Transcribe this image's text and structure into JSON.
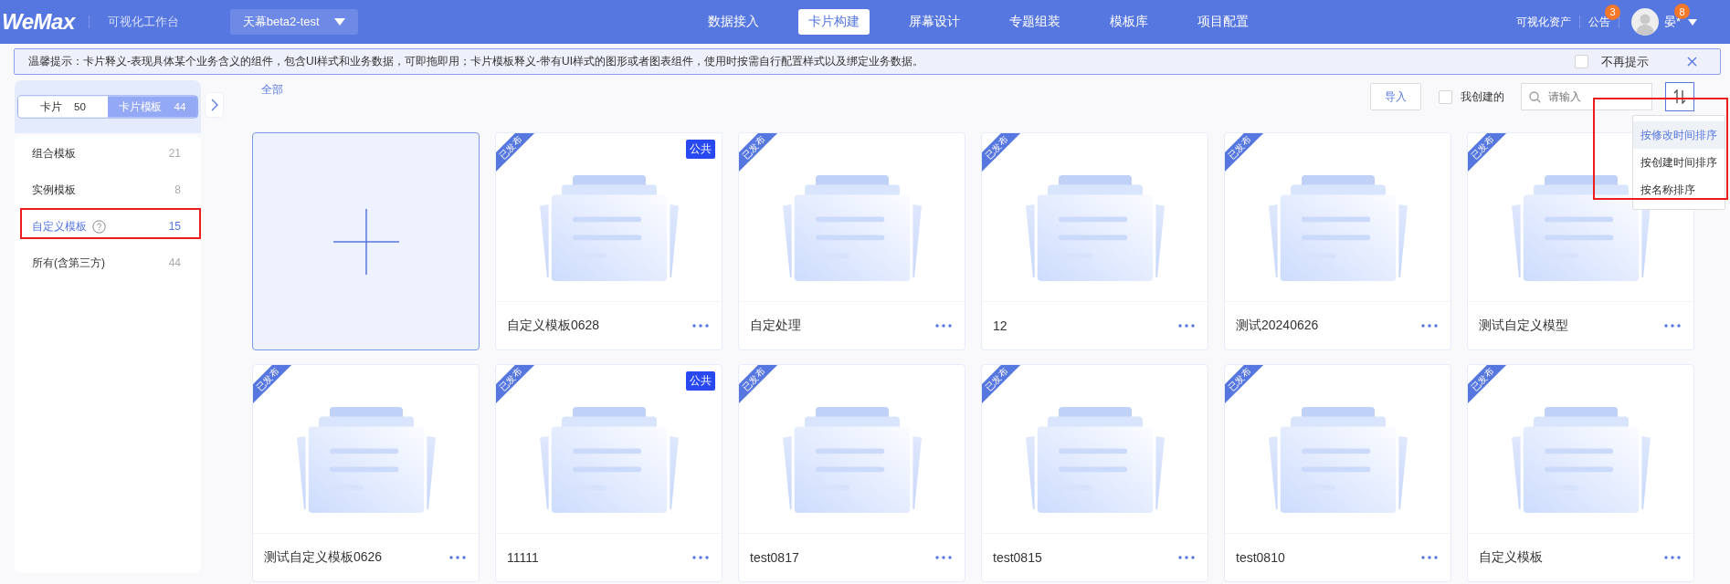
{
  "header": {
    "logo": "WeMax",
    "subtitle": "可视化工作台",
    "project": "天幕beta2-test",
    "nav": [
      {
        "label": "数据接入",
        "selected": false
      },
      {
        "label": "卡片构建",
        "selected": true
      },
      {
        "label": "屏幕设计",
        "selected": false
      },
      {
        "label": "专题组装",
        "selected": false
      },
      {
        "label": "模板库",
        "selected": false
      },
      {
        "label": "项目配置",
        "selected": false
      }
    ],
    "assets": "可视化资产",
    "notice": {
      "label": "公告",
      "badge": "3"
    },
    "user": {
      "name": "晏*",
      "badge": "8"
    }
  },
  "tip": {
    "text": "温馨提示：卡片释义-表现具体某个业务含义的组件，包含UI样式和业务数据，可即拖即用；卡片模板释义-带有UI样式的图形或者图表组件，使用时按需自行配置样式以及绑定业务数据。",
    "dont_show": {
      "label": "不再提示",
      "checked": false
    }
  },
  "sidebar": {
    "tabs": [
      {
        "label": "卡片",
        "count": "50",
        "selected": false
      },
      {
        "label": "卡片模板",
        "count": "44",
        "selected": true
      }
    ],
    "items": [
      {
        "label": "组合模板",
        "count": "21",
        "selected": false,
        "help": false
      },
      {
        "label": "实例模板",
        "count": "8",
        "selected": false,
        "help": false
      },
      {
        "label": "自定义模板",
        "count": "15",
        "selected": true,
        "help": true
      },
      {
        "label": "所有(含第三方)",
        "count": "44",
        "selected": false,
        "help": false
      }
    ]
  },
  "toolbar": {
    "breadcrumb": "全部",
    "import": "导入",
    "mine": {
      "label": "我创建的",
      "checked": false
    },
    "search": {
      "placeholder": "请输入"
    },
    "sort_menu": [
      {
        "label": "按修改时间排序",
        "selected": true
      },
      {
        "label": "按创建时间排序",
        "selected": false
      },
      {
        "label": "按名称排序",
        "selected": false
      }
    ]
  },
  "cards": [
    {
      "kind": "add"
    },
    {
      "kind": "template",
      "name": "自定义模板0628",
      "status": "已发布",
      "tag": "公共"
    },
    {
      "kind": "template",
      "name": "自定处理",
      "status": "已发布"
    },
    {
      "kind": "template",
      "name": "12",
      "status": "已发布"
    },
    {
      "kind": "template",
      "name": "测试20240626",
      "status": "已发布"
    },
    {
      "kind": "template",
      "name": "测试自定义模型",
      "status": "已发布"
    },
    {
      "kind": "template",
      "name": "测试自定义模板0626",
      "status": "已发布"
    },
    {
      "kind": "template",
      "name": "11111",
      "status": "已发布",
      "tag": "公共"
    },
    {
      "kind": "template",
      "name": "test0817",
      "status": "已发布"
    },
    {
      "kind": "template",
      "name": "test0815",
      "status": "已发布"
    },
    {
      "kind": "template",
      "name": "test0810",
      "status": "已发布"
    },
    {
      "kind": "template",
      "name": "自定义模板",
      "status": "已发布"
    }
  ]
}
